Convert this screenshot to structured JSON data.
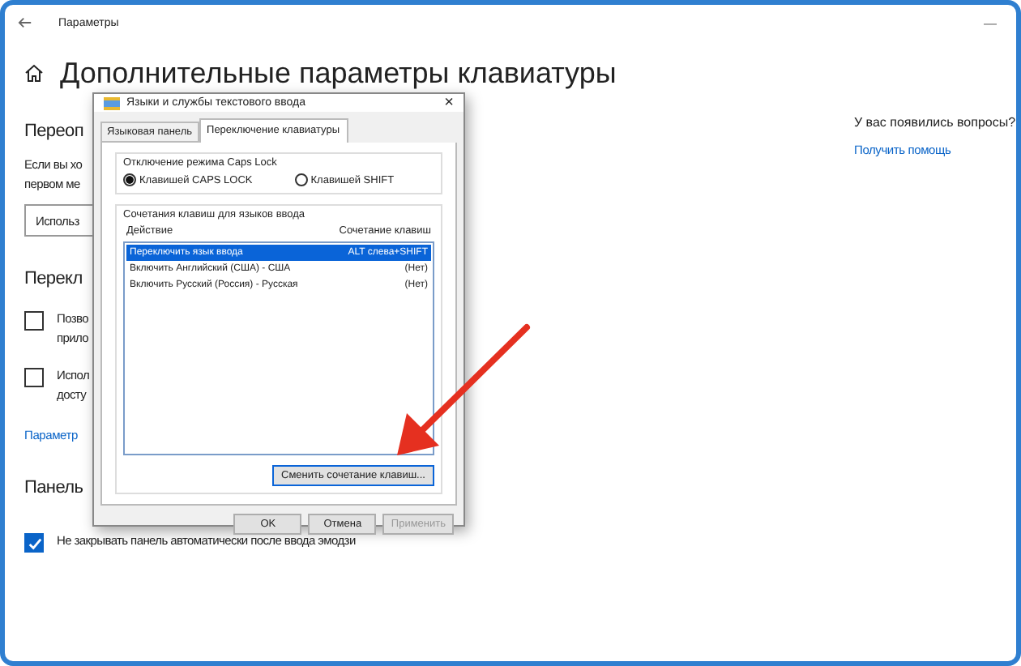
{
  "window": {
    "title": "Параметры",
    "minimize": "—"
  },
  "page": {
    "heading": "Дополнительные параметры клавиатуры",
    "section_1": {
      "title": "Переоп",
      "text_lines": [
        "Если вы хо",
        "первом ме"
      ],
      "dropdown": "Использ"
    },
    "section_2": {
      "title": "Перекл",
      "options": [
        {
          "lines": [
            "Позво",
            "прило"
          ],
          "checked": false
        },
        {
          "lines": [
            "Испол",
            "досту"
          ],
          "checked": false
        }
      ],
      "link": "Параметр"
    },
    "section_3": {
      "title": "Панель",
      "options": [
        {
          "lines": [
            "Не закрывать панель автоматически после ввода эмодзи"
          ],
          "checked": true
        }
      ]
    }
  },
  "help": {
    "question": "У вас появились вопросы?",
    "link": "Получить помощь"
  },
  "dialog": {
    "title": "Языки и службы текстового ввода",
    "close": "×",
    "tabs": [
      {
        "label": "Языковая панель",
        "selected": false
      },
      {
        "label": "Переключение клавиатуры",
        "selected": true
      }
    ],
    "caps_lock": {
      "legend": "Отключение режима Caps Lock",
      "options": [
        {
          "label": "Клавишей CAPS LOCK",
          "selected": true
        },
        {
          "label": "Клавишей SHIFT",
          "selected": false
        }
      ]
    },
    "hotkeys": {
      "legend": "Сочетания клавиш для языков ввода",
      "columns": [
        "Действие",
        "Сочетание клавиш"
      ],
      "rows": [
        {
          "action": "Переключить язык ввода",
          "keys": "ALT слева+SHIFT",
          "selected": true
        },
        {
          "action": "Включить Английский (США) - США",
          "keys": "(Нет)",
          "selected": false
        },
        {
          "action": "Включить Русский (Россия) - Русская",
          "keys": "(Нет)",
          "selected": false
        }
      ],
      "change_button": "Сменить сочетание клавиш..."
    },
    "buttons": [
      {
        "label": "OK",
        "disabled": false
      },
      {
        "label": "Отмена",
        "disabled": false
      },
      {
        "label": "Применить",
        "disabled": true
      }
    ]
  }
}
